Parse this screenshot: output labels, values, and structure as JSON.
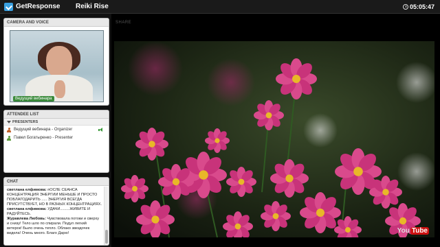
{
  "topbar": {
    "brand": "GetResponse",
    "webinar_title": "Reiki Rise",
    "clock": "05:05:47"
  },
  "camera": {
    "header": "CAMERA AND VOICE",
    "presenter_label": "Ведущий вебинара"
  },
  "attendees": {
    "header": "ATTENDEE LIST",
    "group": "PRESENTERS",
    "items": [
      {
        "name": "Ведущий вебинара - Organizer",
        "role": "organizer"
      },
      {
        "name": "Павел Богатыренко - Presenter",
        "role": "presenter"
      }
    ]
  },
  "chat": {
    "header": "CHAT",
    "messages": [
      {
        "author": "светлана елфимова:",
        "text": " пОСЛЕ СЕАНСА КОНЦЕНТРАЦИЯ ЭНЕРГИИ МЕНЬШЕ И ПРОСТО ПОБЛАГОДАРИТЬ ..... ЭНЕРГИЯ ВСЕГДА ПРИСУТСТВУЕТ, НО В РАЗНЫХ КОНЦЕНТРАЦИЯХ."
      },
      {
        "author": "светлана елфимова:",
        "text": " УДАЧИ.........ЖИВИТЕ И РАДУЙТЕСЬ."
      },
      {
        "author": "Журавлева Любовь:",
        "text": " Чувствовала потоки и сверху и снизу! Тело шло по спирали. Подул легкий ветерок! Было очень тепло. Облако звездочек видела! Очень  много. Благо Дарю!"
      }
    ]
  },
  "stage": {
    "share_label": "SHARE",
    "video_watermark_you": "You",
    "video_watermark_tube": "Tube"
  },
  "colors": {
    "accent": "#3aa0e0",
    "organizer": "#c0622a",
    "presenter": "#5a9a3a",
    "speaking": "#3a9a3a"
  },
  "icons": {
    "logo": "getresponse-check-icon",
    "clock": "clock-icon",
    "organizer": "person-icon",
    "presenter": "person-icon",
    "audio": "speaker-icon"
  }
}
